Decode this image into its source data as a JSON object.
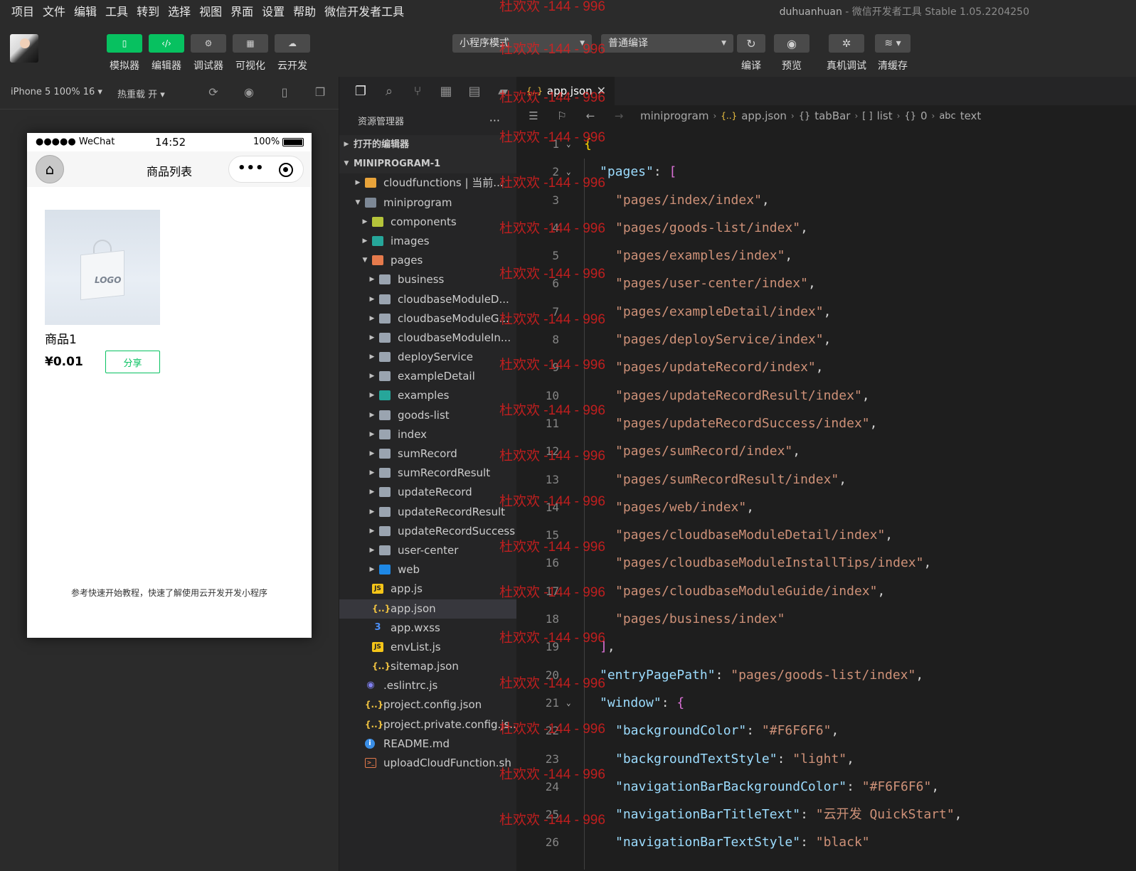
{
  "menubar": {
    "items": [
      "项目",
      "文件",
      "编辑",
      "工具",
      "转到",
      "选择",
      "视图",
      "界面",
      "设置",
      "帮助",
      "微信开发者工具"
    ],
    "user": "duhuanhuan",
    "app_title": "- 微信开发者工具 Stable 1.05.2204250"
  },
  "toolbar": {
    "left_buttons": [
      {
        "label": "模拟器",
        "icon": "phone-icon",
        "active": true
      },
      {
        "label": "编辑器",
        "icon": "code-icon",
        "active": true
      },
      {
        "label": "调试器",
        "icon": "debug-icon",
        "active": false
      },
      {
        "label": "可视化",
        "icon": "layout-icon",
        "active": false
      },
      {
        "label": "云开发",
        "icon": "cloud-icon",
        "active": false
      }
    ],
    "mode_select": "小程序模式",
    "compile_select": "普通编译",
    "right_buttons": [
      {
        "label": "编译",
        "icon": "refresh-icon"
      },
      {
        "label": "预览",
        "icon": "eye-icon"
      },
      {
        "label": "真机调试",
        "icon": "bug-icon"
      },
      {
        "label": "清缓存",
        "icon": "layers-icon"
      }
    ]
  },
  "subbar": {
    "device": "iPhone 5 100% 16 ▾",
    "hotreload": "热重载 开 ▾"
  },
  "simulator": {
    "carrier": "●●●●● WeChat",
    "time": "14:52",
    "battery": "100%",
    "nav_title": "商品列表",
    "goods": {
      "name": "商品1",
      "price": "¥0.01",
      "share": "分享",
      "logo_text": "LOGO"
    },
    "footer_tip": "参考快速开始教程，快速了解使用云开发开发小程序"
  },
  "explorer": {
    "title": "资源管理器",
    "more": "···",
    "tree": [
      {
        "label": "打开的编辑器",
        "type": "section",
        "level": 0,
        "twisty": "▶"
      },
      {
        "label": "MINIPROGRAM-1",
        "type": "section",
        "level": 0,
        "twisty": "▼"
      },
      {
        "label": "cloudfunctions | 当前...",
        "type": "folder-cloud",
        "level": 1,
        "twisty": "▶"
      },
      {
        "label": "miniprogram",
        "type": "folder-open",
        "level": 1,
        "twisty": "▼"
      },
      {
        "label": "components",
        "type": "folder-green",
        "level": 2,
        "twisty": "▶"
      },
      {
        "label": "images",
        "type": "folder-img",
        "level": 2,
        "twisty": "▶"
      },
      {
        "label": "pages",
        "type": "folder-pages",
        "level": 2,
        "twisty": "▼"
      },
      {
        "label": "business",
        "type": "folder",
        "level": 3,
        "twisty": "▶"
      },
      {
        "label": "cloudbaseModuleD...",
        "type": "folder",
        "level": 3,
        "twisty": "▶"
      },
      {
        "label": "cloudbaseModuleG...",
        "type": "folder",
        "level": 3,
        "twisty": "▶"
      },
      {
        "label": "cloudbaseModuleIn...",
        "type": "folder",
        "level": 3,
        "twisty": "▶"
      },
      {
        "label": "deployService",
        "type": "folder",
        "level": 3,
        "twisty": "▶"
      },
      {
        "label": "exampleDetail",
        "type": "folder",
        "level": 3,
        "twisty": "▶"
      },
      {
        "label": "examples",
        "type": "folder-img",
        "level": 3,
        "twisty": "▶"
      },
      {
        "label": "goods-list",
        "type": "folder",
        "level": 3,
        "twisty": "▶"
      },
      {
        "label": "index",
        "type": "folder",
        "level": 3,
        "twisty": "▶"
      },
      {
        "label": "sumRecord",
        "type": "folder",
        "level": 3,
        "twisty": "▶"
      },
      {
        "label": "sumRecordResult",
        "type": "folder",
        "level": 3,
        "twisty": "▶"
      },
      {
        "label": "updateRecord",
        "type": "folder",
        "level": 3,
        "twisty": "▶"
      },
      {
        "label": "updateRecordResult",
        "type": "folder",
        "level": 3,
        "twisty": "▶"
      },
      {
        "label": "updateRecordSuccess",
        "type": "folder",
        "level": 3,
        "twisty": "▶"
      },
      {
        "label": "user-center",
        "type": "folder",
        "level": 3,
        "twisty": "▶"
      },
      {
        "label": "web",
        "type": "folder-web",
        "level": 3,
        "twisty": "▶"
      },
      {
        "label": "app.js",
        "type": "js",
        "level": 2,
        "twisty": ""
      },
      {
        "label": "app.json",
        "type": "json",
        "level": 2,
        "twisty": "",
        "selected": true
      },
      {
        "label": "app.wxss",
        "type": "css",
        "level": 2,
        "twisty": ""
      },
      {
        "label": "envList.js",
        "type": "js",
        "level": 2,
        "twisty": ""
      },
      {
        "label": "sitemap.json",
        "type": "json",
        "level": 2,
        "twisty": ""
      },
      {
        "label": ".eslintrc.js",
        "type": "eslint",
        "level": 1,
        "twisty": ""
      },
      {
        "label": "project.config.json",
        "type": "json",
        "level": 1,
        "twisty": ""
      },
      {
        "label": "project.private.config.js...",
        "type": "json",
        "level": 1,
        "twisty": ""
      },
      {
        "label": "README.md",
        "type": "info",
        "level": 1,
        "twisty": ""
      },
      {
        "label": "uploadCloudFunction.sh",
        "type": "shell",
        "level": 1,
        "twisty": ""
      }
    ]
  },
  "editor": {
    "tab_label": "app.json",
    "breadcrumbs": [
      "miniprogram",
      "app.json",
      "tabBar",
      "list",
      "0",
      "text"
    ],
    "lines": [
      {
        "n": "1",
        "fold": "⌄",
        "indent": 0,
        "parts": [
          [
            "b1",
            "{"
          ]
        ]
      },
      {
        "n": "2",
        "fold": "⌄",
        "indent": 1,
        "parts": [
          [
            "k",
            "\"pages\""
          ],
          [
            "p",
            ": "
          ],
          [
            "b2",
            "["
          ]
        ]
      },
      {
        "n": "3",
        "indent": 2,
        "parts": [
          [
            "s",
            "\"pages/index/index\""
          ],
          [
            "p",
            ","
          ]
        ]
      },
      {
        "n": "4",
        "indent": 2,
        "parts": [
          [
            "s",
            "\"pages/goods-list/index\""
          ],
          [
            "p",
            ","
          ]
        ]
      },
      {
        "n": "5",
        "indent": 2,
        "parts": [
          [
            "s",
            "\"pages/examples/index\""
          ],
          [
            "p",
            ","
          ]
        ]
      },
      {
        "n": "6",
        "indent": 2,
        "parts": [
          [
            "s",
            "\"pages/user-center/index\""
          ],
          [
            "p",
            ","
          ]
        ]
      },
      {
        "n": "7",
        "indent": 2,
        "parts": [
          [
            "s",
            "\"pages/exampleDetail/index\""
          ],
          [
            "p",
            ","
          ]
        ]
      },
      {
        "n": "8",
        "indent": 2,
        "parts": [
          [
            "s",
            "\"pages/deployService/index\""
          ],
          [
            "p",
            ","
          ]
        ]
      },
      {
        "n": "9",
        "indent": 2,
        "parts": [
          [
            "s",
            "\"pages/updateRecord/index\""
          ],
          [
            "p",
            ","
          ]
        ]
      },
      {
        "n": "10",
        "indent": 2,
        "parts": [
          [
            "s",
            "\"pages/updateRecordResult/index\""
          ],
          [
            "p",
            ","
          ]
        ]
      },
      {
        "n": "11",
        "indent": 2,
        "parts": [
          [
            "s",
            "\"pages/updateRecordSuccess/index\""
          ],
          [
            "p",
            ","
          ]
        ]
      },
      {
        "n": "12",
        "indent": 2,
        "parts": [
          [
            "s",
            "\"pages/sumRecord/index\""
          ],
          [
            "p",
            ","
          ]
        ]
      },
      {
        "n": "13",
        "indent": 2,
        "parts": [
          [
            "s",
            "\"pages/sumRecordResult/index\""
          ],
          [
            "p",
            ","
          ]
        ]
      },
      {
        "n": "14",
        "indent": 2,
        "parts": [
          [
            "s",
            "\"pages/web/index\""
          ],
          [
            "p",
            ","
          ]
        ]
      },
      {
        "n": "15",
        "indent": 2,
        "parts": [
          [
            "s",
            "\"pages/cloudbaseModuleDetail/index\""
          ],
          [
            "p",
            ","
          ]
        ]
      },
      {
        "n": "16",
        "indent": 2,
        "parts": [
          [
            "s",
            "\"pages/cloudbaseModuleInstallTips/index\""
          ],
          [
            "p",
            ","
          ]
        ]
      },
      {
        "n": "17",
        "indent": 2,
        "parts": [
          [
            "s",
            "\"pages/cloudbaseModuleGuide/index\""
          ],
          [
            "p",
            ","
          ]
        ]
      },
      {
        "n": "18",
        "indent": 2,
        "parts": [
          [
            "s",
            "\"pages/business/index\""
          ]
        ]
      },
      {
        "n": "19",
        "indent": 1,
        "parts": [
          [
            "b2",
            "]"
          ],
          [
            "p",
            ","
          ]
        ]
      },
      {
        "n": "20",
        "indent": 1,
        "parts": [
          [
            "k",
            "\"entryPagePath\""
          ],
          [
            "p",
            ": "
          ],
          [
            "s",
            "\"pages/goods-list/index\""
          ],
          [
            "p",
            ","
          ]
        ]
      },
      {
        "n": "21",
        "fold": "⌄",
        "indent": 1,
        "parts": [
          [
            "k",
            "\"window\""
          ],
          [
            "p",
            ": "
          ],
          [
            "b2",
            "{"
          ]
        ]
      },
      {
        "n": "22",
        "indent": 2,
        "parts": [
          [
            "k",
            "\"backgroundColor\""
          ],
          [
            "p",
            ": "
          ],
          [
            "s",
            "\"#F6F6F6\""
          ],
          [
            "p",
            ","
          ]
        ]
      },
      {
        "n": "23",
        "indent": 2,
        "parts": [
          [
            "k",
            "\"backgroundTextStyle\""
          ],
          [
            "p",
            ": "
          ],
          [
            "s",
            "\"light\""
          ],
          [
            "p",
            ","
          ]
        ]
      },
      {
        "n": "24",
        "indent": 2,
        "parts": [
          [
            "k",
            "\"navigationBarBackgroundColor\""
          ],
          [
            "p",
            ": "
          ],
          [
            "s",
            "\"#F6F6F6\""
          ],
          [
            "p",
            ","
          ]
        ]
      },
      {
        "n": "25",
        "indent": 2,
        "parts": [
          [
            "k",
            "\"navigationBarTitleText\""
          ],
          [
            "p",
            ": "
          ],
          [
            "s",
            "\"云开发 QuickStart\""
          ],
          [
            "p",
            ","
          ]
        ]
      },
      {
        "n": "26",
        "indent": 2,
        "parts": [
          [
            "k",
            "\"navigationBarTextStyle\""
          ],
          [
            "p",
            ": "
          ],
          [
            "s",
            "\"black\""
          ]
        ]
      }
    ]
  },
  "watermark": "杜欢欢 -144 - 996",
  "colors": {
    "accent_green": "#07c160",
    "editor_bg": "#1e1e1e",
    "watermark": "#dc1e1e"
  }
}
